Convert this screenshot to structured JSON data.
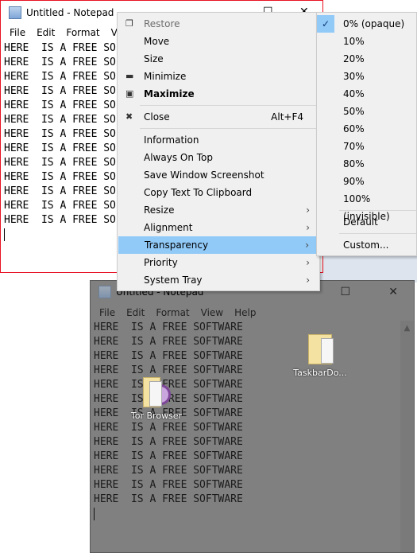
{
  "notepad_front": {
    "title": "Untitled - Notepad",
    "menu": [
      "File",
      "Edit",
      "Format",
      "View"
    ],
    "lines": [
      "HERE  IS A FREE SO",
      "HERE  IS A FREE SO",
      "HERE  IS A FREE SO",
      "HERE  IS A FREE SO",
      "HERE  IS A FREE SO",
      "HERE  IS A FREE SO",
      "HERE  IS A FREE SO",
      "HERE  IS A FREE SO",
      "HERE  IS A FREE SO",
      "HERE  IS A FREE SO",
      "HERE  IS A FREE SO",
      "HERE  IS A FREE SO",
      "HERE  IS A FREE SO"
    ]
  },
  "notepad_back": {
    "title": "Untitled - Notepad",
    "menu": [
      "File",
      "Edit",
      "Format",
      "View",
      "Help"
    ],
    "lines": [
      "HERE  IS A FREE SOFTWARE",
      "HERE  IS A FREE SOFTWARE",
      "HERE  IS A FREE SOFTWARE",
      "HERE  IS A FREE SOFTWARE",
      "HERE  IS A FREE SOFTWARE",
      "HERE  IS A FREE SOFTWARE",
      "HERE  IS A FREE SOFTWARE",
      "HERE  IS A FREE SOFTWARE",
      "HERE  IS A FREE SOFTWARE",
      "HERE  IS A FREE SOFTWARE",
      "HERE  IS A FREE SOFTWARE",
      "HERE  IS A FREE SOFTWARE",
      "HERE  IS A FREE SOFTWARE"
    ]
  },
  "desktop": {
    "tor": "Tor Browser",
    "folder": "TaskbarDo..."
  },
  "context_menu": {
    "restore": "Restore",
    "move": "Move",
    "size": "Size",
    "minimize": "Minimize",
    "maximize": "Maximize",
    "close": "Close",
    "close_shortcut": "Alt+F4",
    "information": "Information",
    "always_on_top": "Always On Top",
    "save_screenshot": "Save Window Screenshot",
    "copy_text": "Copy Text To Clipboard",
    "resize": "Resize",
    "alignment": "Alignment",
    "transparency": "Transparency",
    "priority": "Priority",
    "system_tray": "System Tray"
  },
  "transparency_menu": {
    "options": [
      "0% (opaque)",
      "10%",
      "20%",
      "30%",
      "40%",
      "50%",
      "60%",
      "70%",
      "80%",
      "90%",
      "100% (invisible)"
    ],
    "selected": "0% (opaque)",
    "default": "Default",
    "custom": "Custom..."
  },
  "colors": {
    "highlight": "#91c9f7",
    "active_border": "#e81123"
  }
}
